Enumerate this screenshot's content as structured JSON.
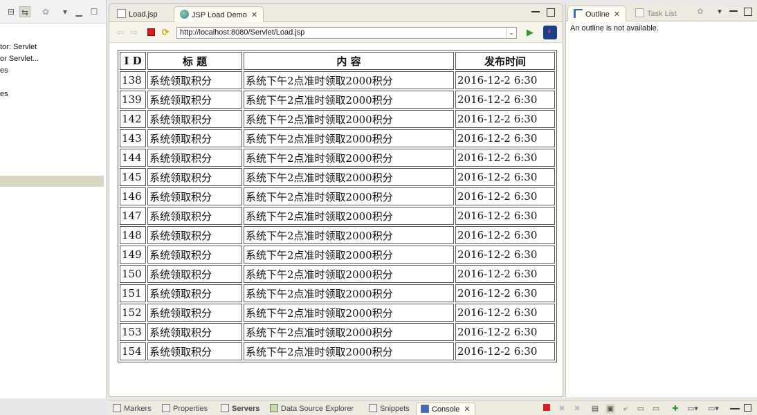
{
  "left_panel": {
    "items": [
      "tor: Servlet",
      "or Servlet...",
      "es",
      "",
      "es"
    ]
  },
  "editor": {
    "tabs": [
      {
        "label": "Load.jsp",
        "active": false
      },
      {
        "label": "JSP Load Demo",
        "active": true
      }
    ],
    "url": "http://localhost:8080/Servlet/Load.jsp"
  },
  "table": {
    "headers": [
      "I D",
      "标 题",
      "内 容",
      "发布时间"
    ],
    "rows": [
      [
        "138",
        "系统领取积分",
        "系统下午2点准时领取2000积分",
        "2016-12-2 6:30"
      ],
      [
        "139",
        "系统领取积分",
        "系统下午2点准时领取2000积分",
        "2016-12-2 6:30"
      ],
      [
        "142",
        "系统领取积分",
        "系统下午2点准时领取2000积分",
        "2016-12-2 6:30"
      ],
      [
        "143",
        "系统领取积分",
        "系统下午2点准时领取2000积分",
        "2016-12-2 6:30"
      ],
      [
        "144",
        "系统领取积分",
        "系统下午2点准时领取2000积分",
        "2016-12-2 6:30"
      ],
      [
        "145",
        "系统领取积分",
        "系统下午2点准时领取2000积分",
        "2016-12-2 6:30"
      ],
      [
        "146",
        "系统领取积分",
        "系统下午2点准时领取2000积分",
        "2016-12-2 6:30"
      ],
      [
        "147",
        "系统领取积分",
        "系统下午2点准时领取2000积分",
        "2016-12-2 6:30"
      ],
      [
        "148",
        "系统领取积分",
        "系统下午2点准时领取2000积分",
        "2016-12-2 6:30"
      ],
      [
        "149",
        "系统领取积分",
        "系统下午2点准时领取2000积分",
        "2016-12-2 6:30"
      ],
      [
        "150",
        "系统领取积分",
        "系统下午2点准时领取2000积分",
        "2016-12-2 6:30"
      ],
      [
        "151",
        "系统领取积分",
        "系统下午2点准时领取2000积分",
        "2016-12-2 6:30"
      ],
      [
        "152",
        "系统领取积分",
        "系统下午2点准时领取2000积分",
        "2016-12-2 6:30"
      ],
      [
        "153",
        "系统领取积分",
        "系统下午2点准时领取2000积分",
        "2016-12-2 6:30"
      ],
      [
        "154",
        "系统领取积分",
        "系统下午2点准时领取2000积分",
        "2016-12-2 6:30"
      ]
    ]
  },
  "outline": {
    "tabs": [
      {
        "label": "Outline",
        "active": true
      },
      {
        "label": "Task List",
        "active": false
      }
    ],
    "message": "An outline is not available."
  },
  "bottom_tabs": [
    {
      "label": "Markers",
      "active": false
    },
    {
      "label": "Properties",
      "active": false
    },
    {
      "label": "Servers",
      "active": false
    },
    {
      "label": "Data Source Explorer",
      "active": false
    },
    {
      "label": "Snippets",
      "active": false
    },
    {
      "label": "Console",
      "active": true
    }
  ],
  "colors": {
    "selection": "#d9d6c1",
    "stop_red": "#d82020",
    "run_green": "#2a9a2a"
  }
}
